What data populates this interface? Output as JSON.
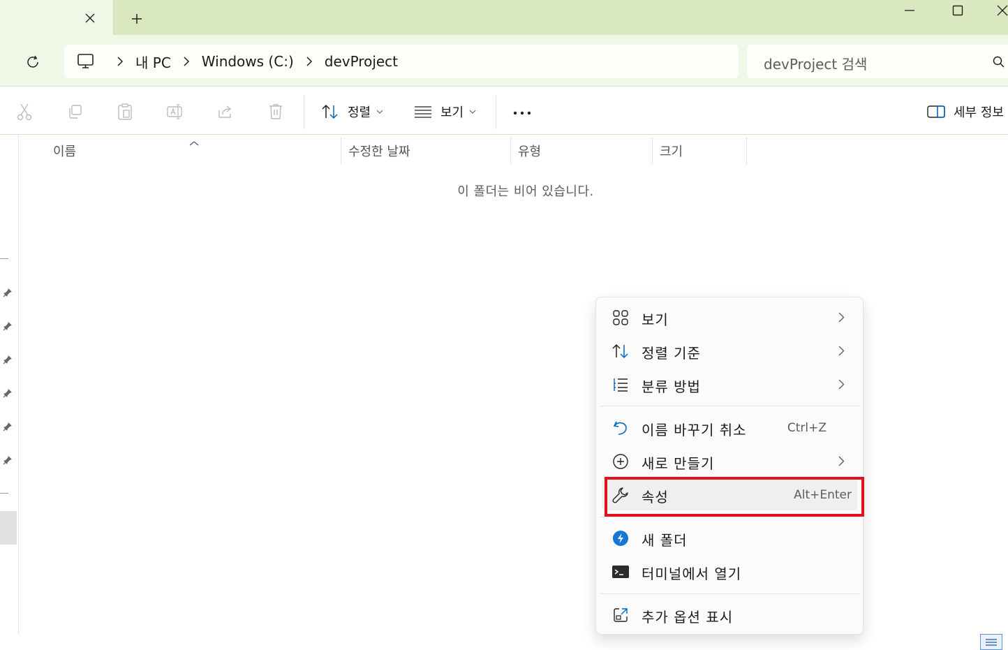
{
  "breadcrumb": {
    "items": [
      "내 PC",
      "Windows (C:)",
      "devProject"
    ]
  },
  "search": {
    "placeholder": "devProject 검색"
  },
  "toolbar": {
    "sort_label": "정렬",
    "view_label": "보기",
    "details_label": "세부 정보"
  },
  "columns": {
    "name": "이름",
    "date": "수정한 날짜",
    "type": "유형",
    "size": "크기"
  },
  "list": {
    "empty_message": "이 폴더는 비어 있습니다."
  },
  "context_menu": {
    "items": [
      {
        "label": "보기",
        "icon": "grid-icon",
        "shortcut": "",
        "submenu": true
      },
      {
        "label": "정렬 기준",
        "icon": "sort-icon",
        "shortcut": "",
        "submenu": true
      },
      {
        "label": "분류 방법",
        "icon": "group-by-icon",
        "shortcut": "",
        "submenu": true
      },
      {
        "label": "이름 바꾸기 취소",
        "icon": "undo-icon",
        "shortcut": "Ctrl+Z",
        "submenu": false
      },
      {
        "label": "새로 만들기",
        "icon": "add-circle-icon",
        "shortcut": "",
        "submenu": true
      },
      {
        "label": "속성",
        "icon": "wrench-icon",
        "shortcut": "Alt+Enter",
        "submenu": false
      },
      {
        "label": "새 폴더",
        "icon": "app-icon",
        "shortcut": "",
        "submenu": false
      },
      {
        "label": "터미널에서 열기",
        "icon": "terminal-icon",
        "shortcut": "",
        "submenu": false
      },
      {
        "label": "추가 옵션 표시",
        "icon": "expand-icon",
        "shortcut": "",
        "submenu": false
      }
    ]
  },
  "colors": {
    "titlebar": "#d9e8be",
    "accent": "#0067c0",
    "highlight_box": "#e0121e"
  }
}
